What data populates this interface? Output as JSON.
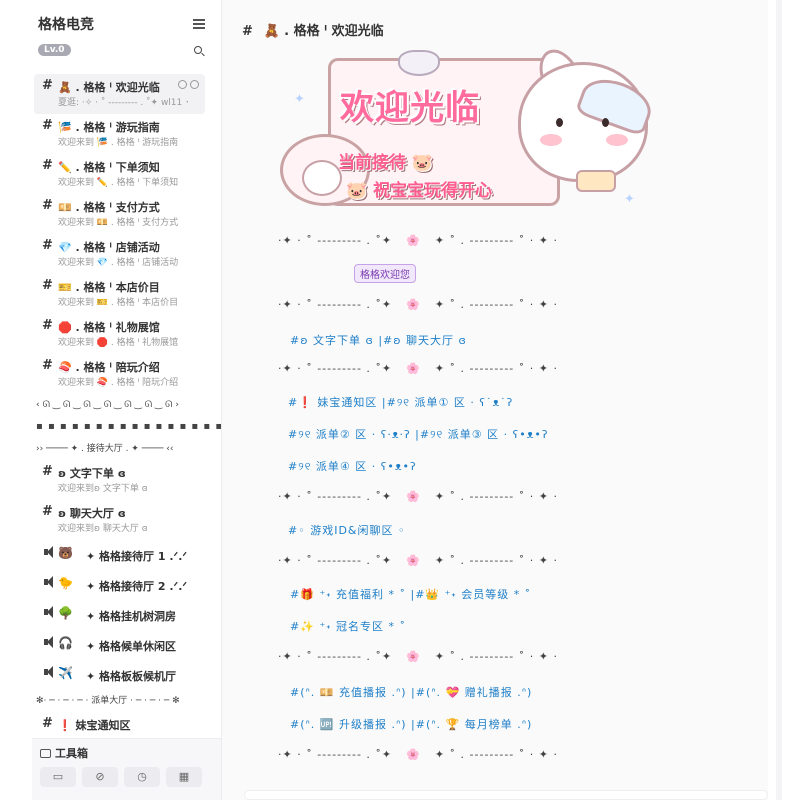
{
  "sidebar": {
    "guild_name": "格格电竞",
    "level": "Lv.0",
    "menu_icon": "menu-icon",
    "search_icon": "search-icon",
    "channels": [
      {
        "hash": "#",
        "name": "🧸 . 格格 ᑊ 欢迎光临",
        "sub": "夏逛: ·✧ · ˚ --------- . ˚✦ wl11 ✦",
        "active": true
      },
      {
        "hash": "#",
        "name": "🎏 . 格格 ᑊ 游玩指南",
        "sub": "欢迎来到 🎏 . 格格 ᑊ 游玩指南",
        "active": false
      },
      {
        "hash": "#",
        "name": "✏️ . 格格 ᑊ 下单须知",
        "sub": "欢迎来到 ✏️ . 格格 ᑊ 下单须知",
        "active": false
      },
      {
        "hash": "#",
        "name": "💴 . 格格 ᑊ 支付方式",
        "sub": "欢迎来到 💴 . 格格 ᑊ 支付方式",
        "active": false
      },
      {
        "hash": "#",
        "name": "💎 . 格格 ᑊ 店铺活动",
        "sub": "欢迎来到 💎 . 格格 ᑊ 店铺活动",
        "active": false
      },
      {
        "hash": "#",
        "name": "🎫 . 格格 ᑊ 本店价目",
        "sub": "欢迎来到 🎫 . 格格 ᑊ 本店价目",
        "active": false
      },
      {
        "hash": "#",
        "name": "🛑 . 格格 ᑊ 礼物展馆",
        "sub": "欢迎来到 🛑 . 格格 ᑊ 礼物展馆",
        "active": false
      },
      {
        "hash": "#",
        "name": "🍣 . 格格 ᑊ 陪玩介绍",
        "sub": "欢迎来到 🍣 . 格格 ᑊ 陪玩介绍",
        "active": false
      }
    ],
    "divider_wave": "‹ ᘏ ‿ ᘏ ‿ ᘏ ‿ ᘏ ‿ ᘏ ‿ ᘏ ‿ ᘏ ›",
    "divider_dots": "▪ ▪ ▪ ▪ ▪ ▪ ▪ ▪ ▪ ▪ ▪ ▪ ▪ ▪ ▪ ▪",
    "divider_reception": "›› ──── ✦ . 接待大厅 . ✦ ──── ‹‹",
    "text_channels": [
      {
        "hash": "#",
        "name": "ʚ 文字下单 ɞ",
        "sub": "欢迎来到ʚ 文字下单 ɞ"
      },
      {
        "hash": "#",
        "name": "ʚ 聊天大厅 ɞ",
        "sub": "欢迎来到ʚ 聊天大厅 ɞ"
      }
    ],
    "voice_channels": [
      {
        "emoji": "🐻",
        "name": "✦ 格格接待厅 1 .ᐟ.ᐟ"
      },
      {
        "emoji": "🐤",
        "name": "✦ 格格接待厅 2 .ᐟ.ᐟ"
      },
      {
        "emoji": "🌳",
        "name": "✦ 格格挂机树洞房"
      },
      {
        "emoji": "🎧",
        "name": "✦ 格格候单休闲区"
      },
      {
        "emoji": "✈️",
        "name": "✦ 格格板板候机厅"
      }
    ],
    "divider_dispatch": "✻· ─ · ─ · ─ · 派单大厅 · ─ · ─ · ─ ✻",
    "bottom_channel": {
      "hash": "#",
      "name": "❗ 妹宝通知区"
    },
    "toolbox": {
      "title": "工具箱",
      "buttons": [
        "▭",
        "⊘",
        "◷",
        "▦"
      ]
    }
  },
  "main": {
    "header": {
      "hash": "#",
      "title": "🧸 . 格格 ᑊ 欢迎光临"
    },
    "banner": {
      "title": "欢迎光临",
      "sub1": "当前接待 🐷",
      "sub2": "🐷 祝宝宝玩得开心"
    },
    "deco_line": {
      "left": "·✦ · ˚ --------- . ˚✦",
      "mid": "🌸",
      "right": "✦ ˚ . --------- ˚ · ✦ ·"
    },
    "welcome_tag": "格格欢迎您",
    "links": [
      {
        "row": 1,
        "text": "#ʚ 文字下单 ɞ    |#ʚ 聊天大厅 ɞ"
      },
      {
        "row": 2,
        "text": "#❗ 妹宝通知区    |#୨୧ 派单① 区 · ʕ˙ᴥ˙ʔ"
      },
      {
        "row": 3,
        "text": "#୨୧ 派单② 区 · ʕ·ᴥ·ʔ    |#୨୧ 派单③ 区 · ʕ•ᴥ•ʔ"
      },
      {
        "row": 4,
        "text": "#୨୧ 派单④ 区 · ʕ•ᴥ•ʔ"
      },
      {
        "row": 5,
        "text": "#◦ 游戏ID&闲聊区 ◦"
      },
      {
        "row": 6,
        "text": "#🎁 ⁺˖ 充值福利 * ˚    |#👑 ⁺˖ 会员等级 * ˚"
      },
      {
        "row": 7,
        "text": "#✨ ⁺˖ 冠名专区 * ˚"
      },
      {
        "row": 8,
        "text": "#(ᐢ. 💴 充值播报 .ᐢ)    |#(ᐢ. 💝 赠礼播报 .ᐢ)"
      },
      {
        "row": 9,
        "text": "#(ᐢ. 🆙 升级播报 .ᐢ)    |#(ᐢ. 🏆 每月榜单 .ᐢ)"
      }
    ]
  }
}
